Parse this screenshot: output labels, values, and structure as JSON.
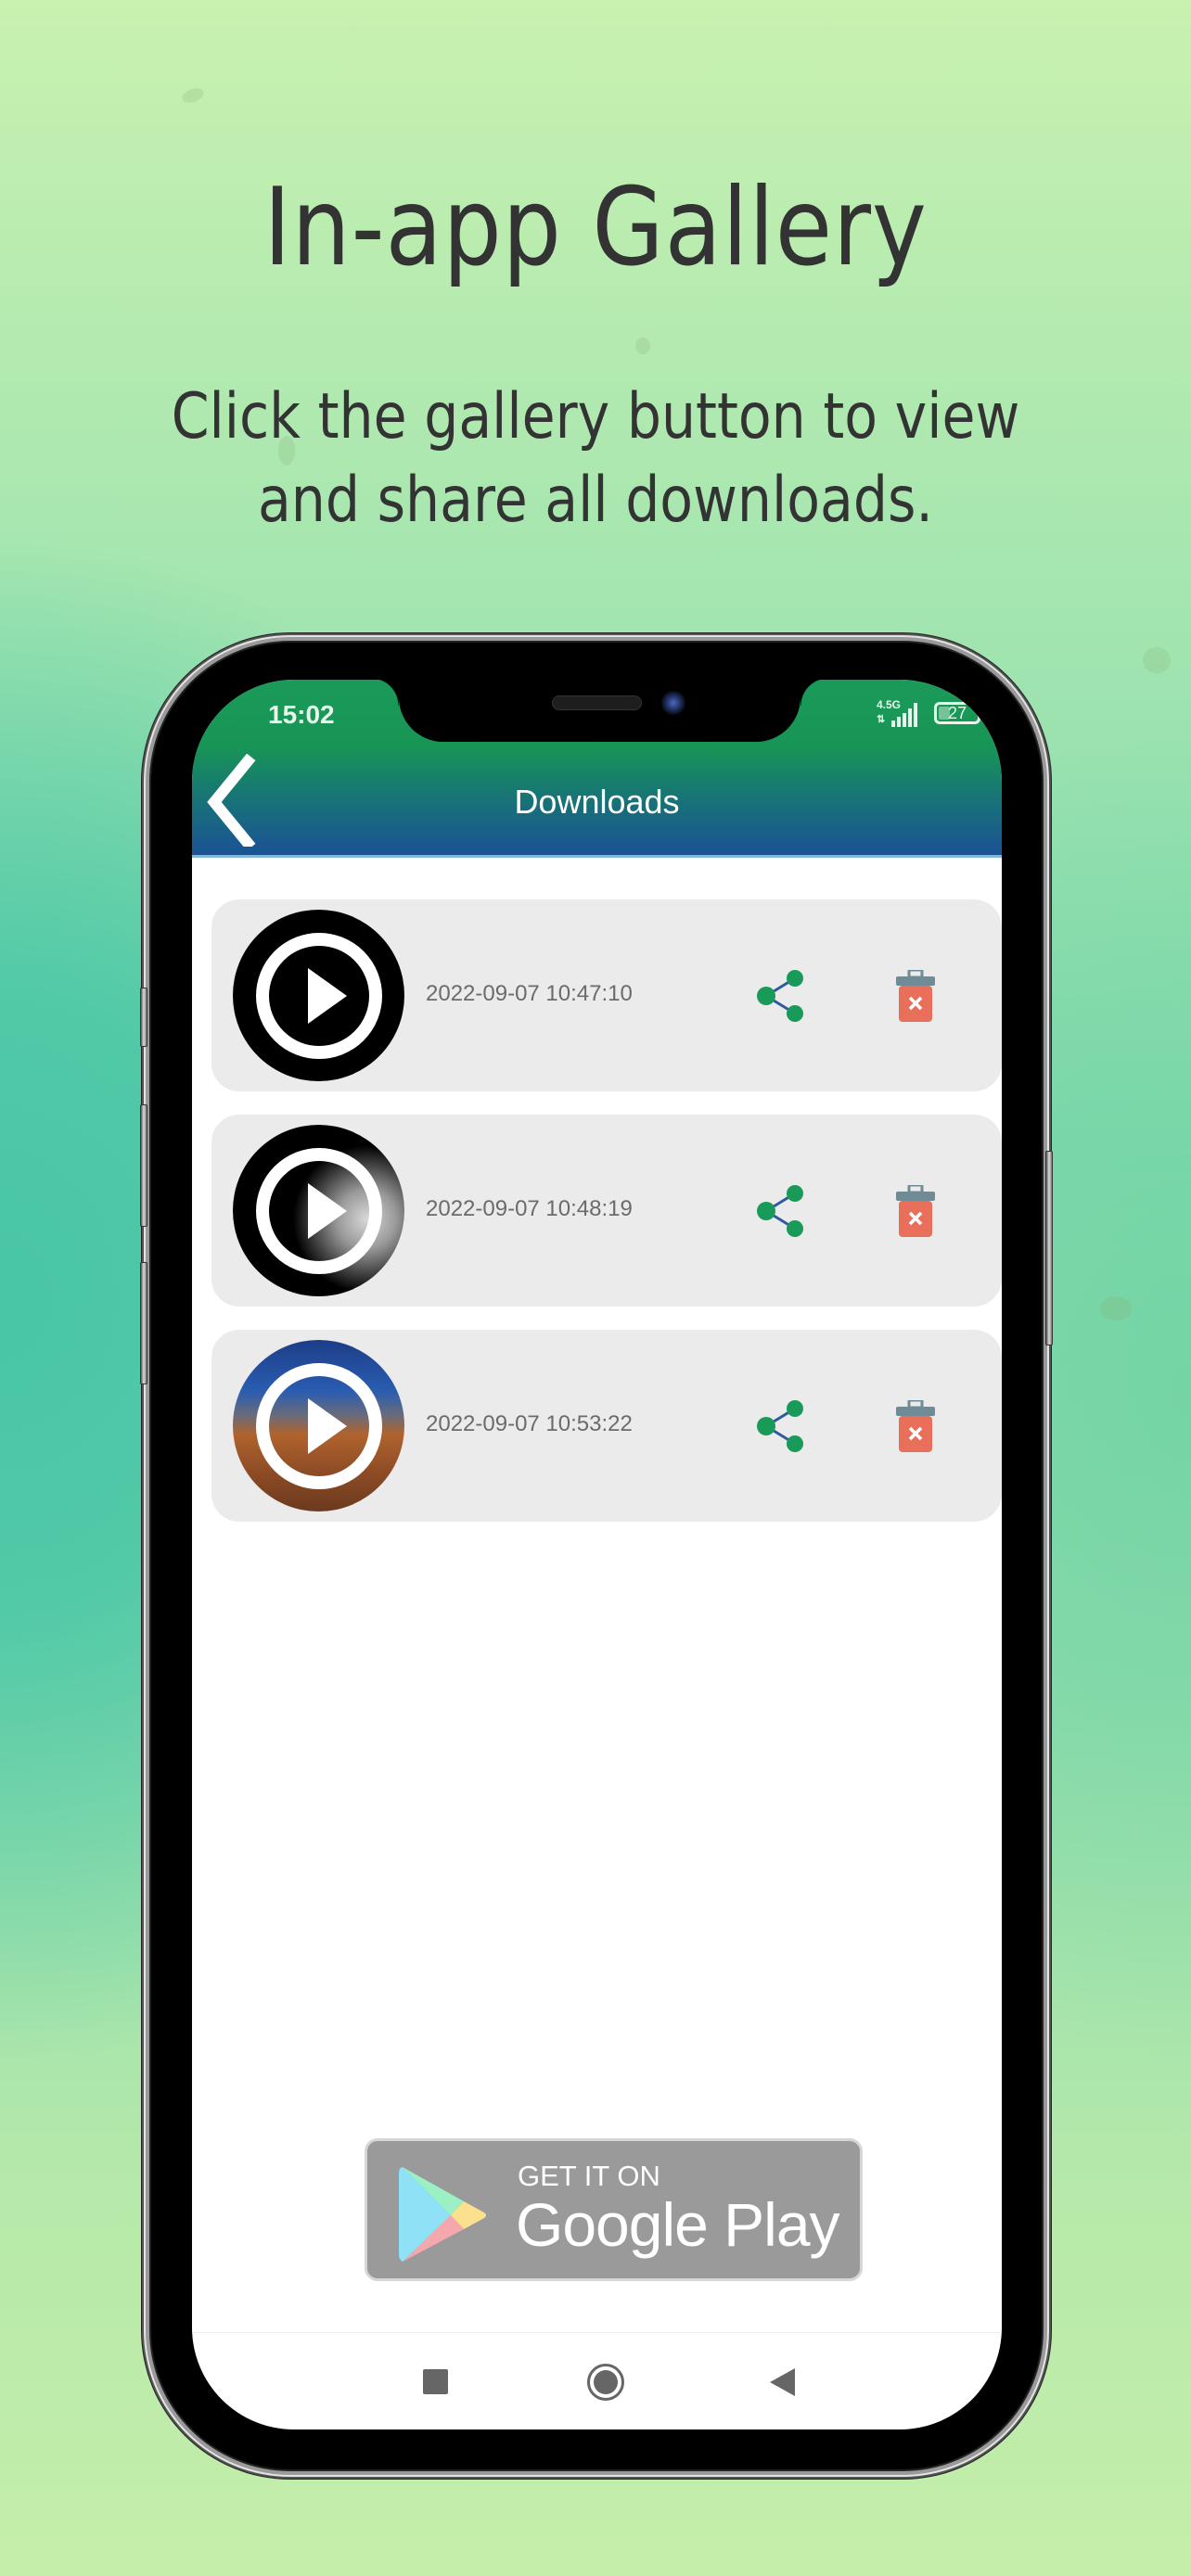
{
  "promo": {
    "title": "In-app Gallery",
    "subtitle_line1": "Click the gallery button to view",
    "subtitle_line2": "and share all downloads."
  },
  "status_bar": {
    "time": "15:02",
    "network_type": "4.5G",
    "network_arrows": "⇅",
    "battery_level": "27",
    "signal_bars_filled": 4
  },
  "app_header": {
    "title": "Downloads",
    "back_icon": "chevron-left-icon"
  },
  "downloads": [
    {
      "timestamp": "2022-09-07 10:47:10",
      "thumbnail": "black",
      "play_icon": "play-circle-icon",
      "share_icon": "share-icon",
      "delete_icon": "trash-x-icon"
    },
    {
      "timestamp": "2022-09-07 10:48:19",
      "thumbnail": "moon",
      "play_icon": "play-circle-icon",
      "share_icon": "share-icon",
      "delete_icon": "trash-x-icon"
    },
    {
      "timestamp": "2022-09-07 10:53:22",
      "thumbnail": "nebula",
      "play_icon": "play-circle-icon",
      "share_icon": "share-icon",
      "delete_icon": "trash-x-icon"
    }
  ],
  "store_badge": {
    "line1": "GET IT ON",
    "line2": "Google Play"
  },
  "nav_bar": {
    "recent_icon": "square-icon",
    "home_icon": "circle-icon",
    "back_icon": "triangle-back-icon"
  },
  "colors": {
    "header_top": "#1a9a58",
    "header_bottom": "#1b5295",
    "share_dot": "#1a9a58",
    "share_line": "#2f5a9e",
    "trash_body": "#e8705a",
    "trash_lid": "#6f8c96",
    "item_bg": "#ebebeb",
    "badge_bg": "#9a9a9a",
    "headline_text": "#333333"
  }
}
